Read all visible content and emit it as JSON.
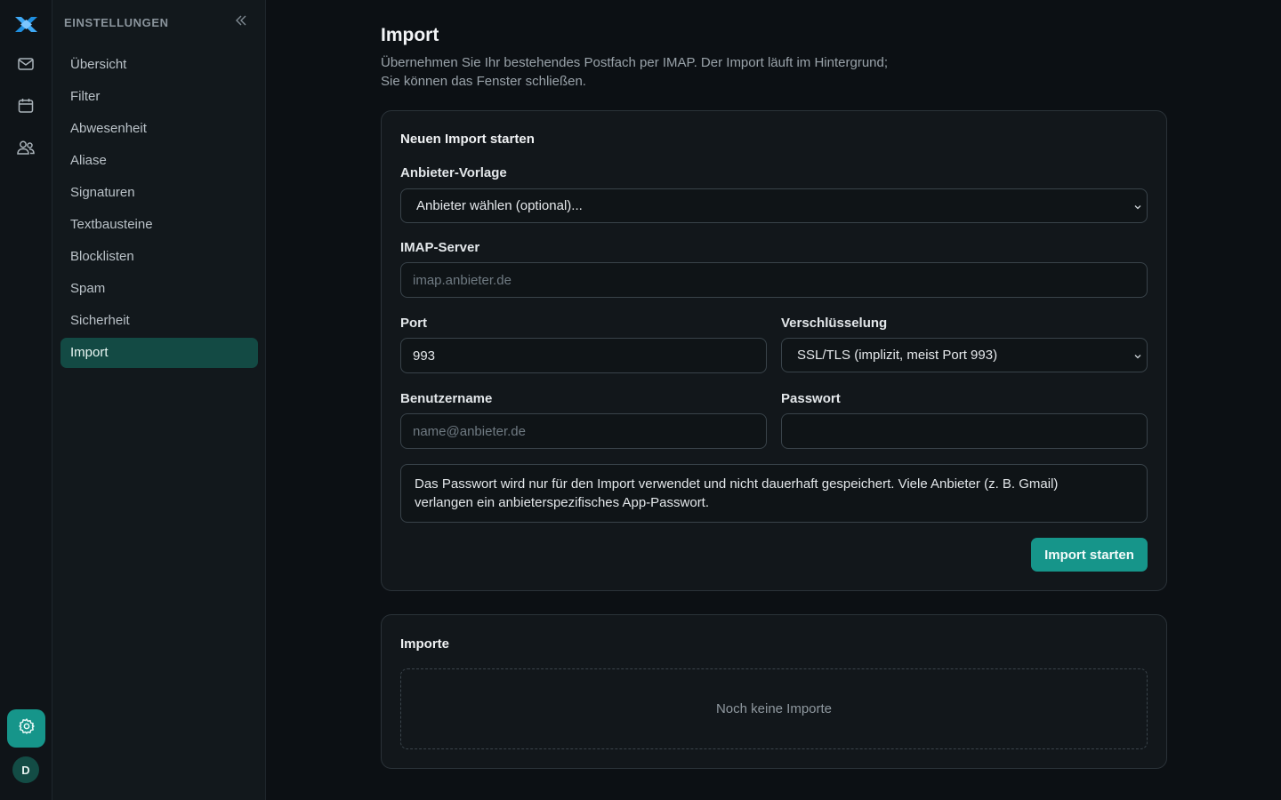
{
  "sidebar": {
    "title": "EINSTELLUNGEN",
    "items": [
      {
        "label": "Übersicht"
      },
      {
        "label": "Filter"
      },
      {
        "label": "Abwesenheit"
      },
      {
        "label": "Aliase"
      },
      {
        "label": "Signaturen"
      },
      {
        "label": "Textbausteine"
      },
      {
        "label": "Blocklisten"
      },
      {
        "label": "Spam"
      },
      {
        "label": "Sicherheit"
      },
      {
        "label": "Import",
        "active": true
      }
    ]
  },
  "rail": {
    "icons": [
      "logo-icon",
      "mail-icon",
      "calendar-icon",
      "contacts-icon",
      "gear-icon"
    ],
    "avatar_initial": "D"
  },
  "page": {
    "title": "Import",
    "description_line1": "Übernehmen Sie Ihr bestehendes Postfach per IMAP. Der Import läuft im Hintergrund;",
    "description_line2": "Sie können das Fenster schließen."
  },
  "form": {
    "heading": "Neuen Import starten",
    "provider_label": "Anbieter-Vorlage",
    "provider_value": "Anbieter wählen (optional)...",
    "server_label": "IMAP-Server",
    "server_placeholder": "imap.anbieter.de",
    "port_label": "Port",
    "port_value": "993",
    "encryption_label": "Verschlüsselung",
    "encryption_value": "SSL/TLS (implizit, meist Port 993)",
    "username_label": "Benutzername",
    "username_placeholder": "name@anbieter.de",
    "password_label": "Passwort",
    "password_value": "",
    "note_line1": "Das Passwort wird nur für den Import verwendet und nicht dauerhaft gespeichert. Viele Anbieter (z. B. Gmail)",
    "note_line2": "verlangen ein anbieterspezifisches App-Passwort.",
    "submit_label": "Import starten"
  },
  "imports": {
    "heading": "Importe",
    "empty_text": "Noch keine Importe"
  },
  "colors": {
    "accent": "#16958a",
    "active_bg": "#134a44",
    "background": "#0c1014"
  }
}
